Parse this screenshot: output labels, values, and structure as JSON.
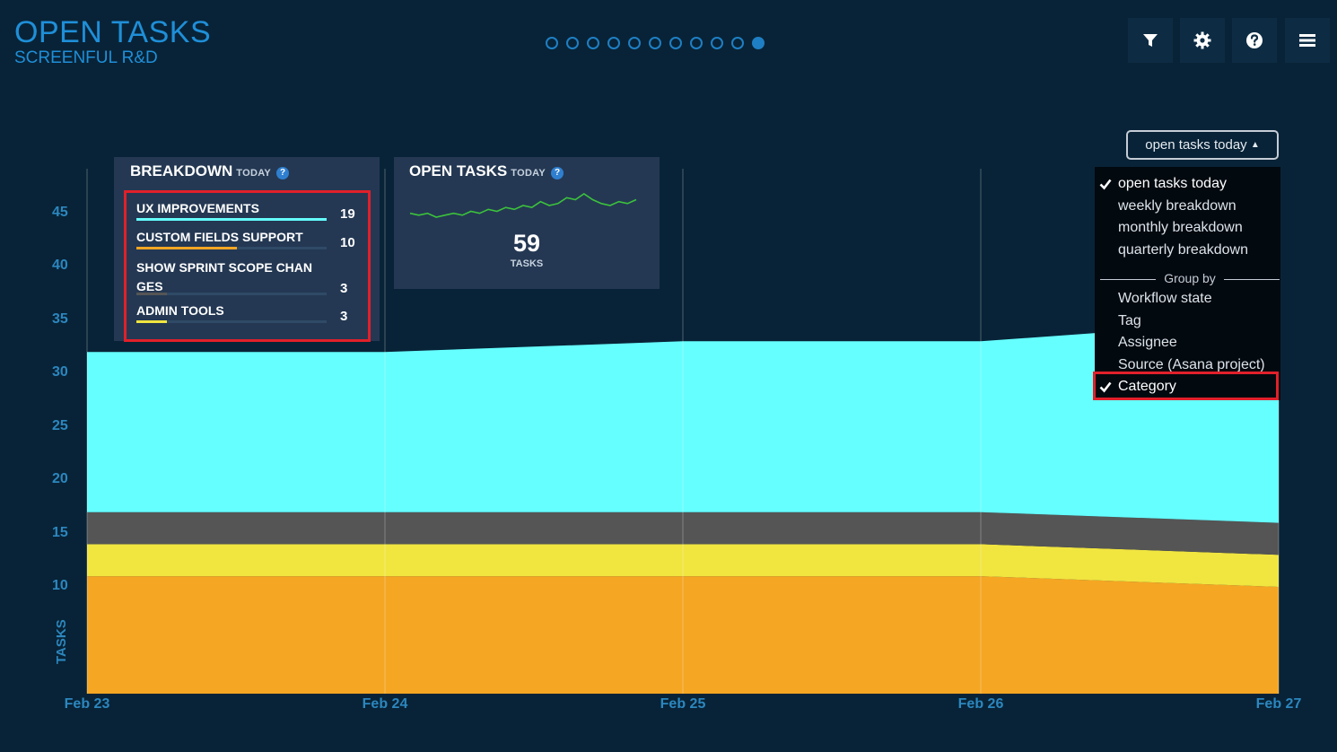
{
  "header": {
    "title": "OPEN TASKS",
    "subtitle": "SCREENFUL R&D"
  },
  "pager": {
    "count": 11,
    "active_index": 10
  },
  "toolbar": {
    "buttons": [
      {
        "name": "filter",
        "icon": "filter-icon"
      },
      {
        "name": "settings",
        "icon": "gear-icon"
      },
      {
        "name": "help",
        "icon": "help-icon"
      },
      {
        "name": "menu",
        "icon": "menu-icon"
      }
    ]
  },
  "breakdown": {
    "title": "BREAKDOWN",
    "qualifier": "TODAY",
    "items": [
      {
        "label": "UX IMPROVEMENTS",
        "count": "19",
        "color": "#66ffff",
        "fraction": 1.0
      },
      {
        "label": "CUSTOM FIELDS SUPPORT",
        "count": "10",
        "color": "#f5a623",
        "fraction": 0.53
      },
      {
        "label": "SHOW SPRINT SCOPE CHAN GES",
        "count": "3",
        "color": "#555555",
        "fraction": 0.16
      },
      {
        "label": "ADMIN TOOLS",
        "count": "3",
        "color": "#f1e540",
        "fraction": 0.16
      }
    ]
  },
  "open_tasks_panel": {
    "title": "OPEN TASKS",
    "qualifier": "TODAY",
    "value": "59",
    "unit": "TASKS",
    "sparkline_color": "#3cc23c"
  },
  "dropdown": {
    "button_label": "open tasks today",
    "views": [
      {
        "label": "open tasks today",
        "checked": true
      },
      {
        "label": "weekly breakdown",
        "checked": false
      },
      {
        "label": "monthly breakdown",
        "checked": false
      },
      {
        "label": "quarterly breakdown",
        "checked": false
      }
    ],
    "group_by_label": "Group by",
    "groups": [
      {
        "label": "Workflow state",
        "checked": false
      },
      {
        "label": "Tag",
        "checked": false
      },
      {
        "label": "Assignee",
        "checked": false
      },
      {
        "label": "Source (Asana project)",
        "checked": false
      },
      {
        "label": "Category",
        "checked": true
      }
    ]
  },
  "chart_data": {
    "type": "area",
    "stacked": true,
    "ylabel": "TASKS",
    "xlabel": "",
    "x": [
      "Feb 23",
      "Feb 24",
      "Feb 25",
      "Feb 26",
      "Feb 27"
    ],
    "yticks": [
      10,
      15,
      20,
      25,
      30,
      35,
      40,
      45
    ],
    "ylim": [
      0,
      49
    ],
    "grid": "vertical",
    "series": [
      {
        "name": "CUSTOM FIELDS SUPPORT",
        "color": "#f5a623",
        "values": [
          11,
          11,
          11,
          11,
          10
        ]
      },
      {
        "name": "ADMIN TOOLS",
        "color": "#f1e540",
        "values": [
          3,
          3,
          3,
          3,
          3
        ]
      },
      {
        "name": "SHOW SPRINT SCOPE CHAN GES",
        "color": "#555555",
        "values": [
          3,
          3,
          3,
          3,
          3
        ]
      },
      {
        "name": "UX IMPROVEMENTS",
        "color": "#66ffff",
        "values": [
          15,
          15,
          16,
          16,
          19
        ]
      }
    ],
    "sparkline": [
      30,
      29,
      30,
      28,
      29,
      30,
      29,
      31,
      30,
      32,
      31,
      33,
      32,
      34,
      33,
      36,
      34,
      35,
      38,
      37,
      40,
      37,
      35,
      34,
      36,
      35,
      37
    ]
  }
}
